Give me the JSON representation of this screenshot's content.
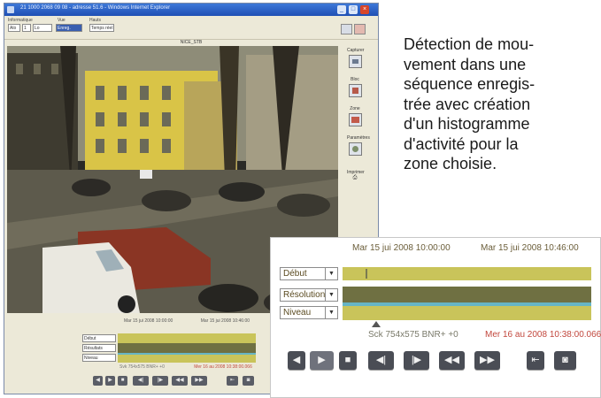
{
  "window": {
    "title": "21 1000 2068 09 08 - adresse 51.6 - Windows Internet Explorer",
    "controls": [
      "_",
      "□",
      "×"
    ]
  },
  "toolbar": {
    "labels": [
      "Informatique",
      "Vue",
      "Hauts"
    ],
    "fields": [
      "Alo",
      "1",
      "Lo",
      "Enreg.",
      "Temps réel"
    ]
  },
  "camera": {
    "name": "NICE_STB"
  },
  "side_tools": [
    {
      "label": "Capturer",
      "icon": "camera-icon"
    },
    {
      "label": "Bloc",
      "icon": "film-icon"
    },
    {
      "label": "Zone",
      "icon": "zone-icon"
    },
    {
      "label": "Paramètres",
      "icon": "settings-icon"
    },
    {
      "label": "Imprimer",
      "icon": "print-icon"
    }
  ],
  "mini": {
    "dates": [
      "Mar 15 jui 2008 10:00:00",
      "Mar 15 jui 2008 10:46:00"
    ],
    "selects": [
      "Début",
      "Résultats",
      "Niveau"
    ],
    "footer_left": "Svk 754x575 BNR+ +0",
    "footer_right": "Mer 16 au 2008 10:38:00.066",
    "controls": [
      "◀",
      "▶",
      "■",
      "◀|",
      "|▶",
      "◀◀",
      "▶▶"
    ]
  },
  "caption": [
    "Détection de mou-",
    "vement dans une",
    "séquence enregis-",
    "trée avec création",
    "d'un histogramme",
    "d'activité pour la",
    "zone choisie."
  ],
  "zoom": {
    "date_start": "Mar 15 jui 2008 10:00:00",
    "date_end": "Mar 15 jui 2008 10:46:00",
    "selects": [
      {
        "value": "Début",
        "arrow": "▼"
      },
      {
        "value": "Résolution",
        "arrow": "▼"
      },
      {
        "value": "Niveau",
        "arrow": "▼"
      }
    ],
    "footer_left": "Sck 754x575 BNR+ +0",
    "footer_right": "Mer 16 au 2008 10:38:00.066",
    "controls": [
      {
        "name": "rewind",
        "glyph": "◀"
      },
      {
        "name": "play",
        "glyph": "▶"
      },
      {
        "name": "stop",
        "glyph": "■"
      },
      {
        "name": "frame-back",
        "glyph": "◀|"
      },
      {
        "name": "frame-forward",
        "glyph": "|▶"
      },
      {
        "name": "step-back",
        "glyph": "◀◀"
      },
      {
        "name": "step-forward",
        "glyph": "▶▶"
      },
      {
        "name": "export",
        "glyph": "⇤"
      },
      {
        "name": "snapshot",
        "glyph": "◙"
      }
    ]
  },
  "colors": {
    "track_yellow": "#c9c45a",
    "track_dark": "#6f7042",
    "track_cyan": "#66b5c5",
    "accent_red": "#c2483e"
  }
}
